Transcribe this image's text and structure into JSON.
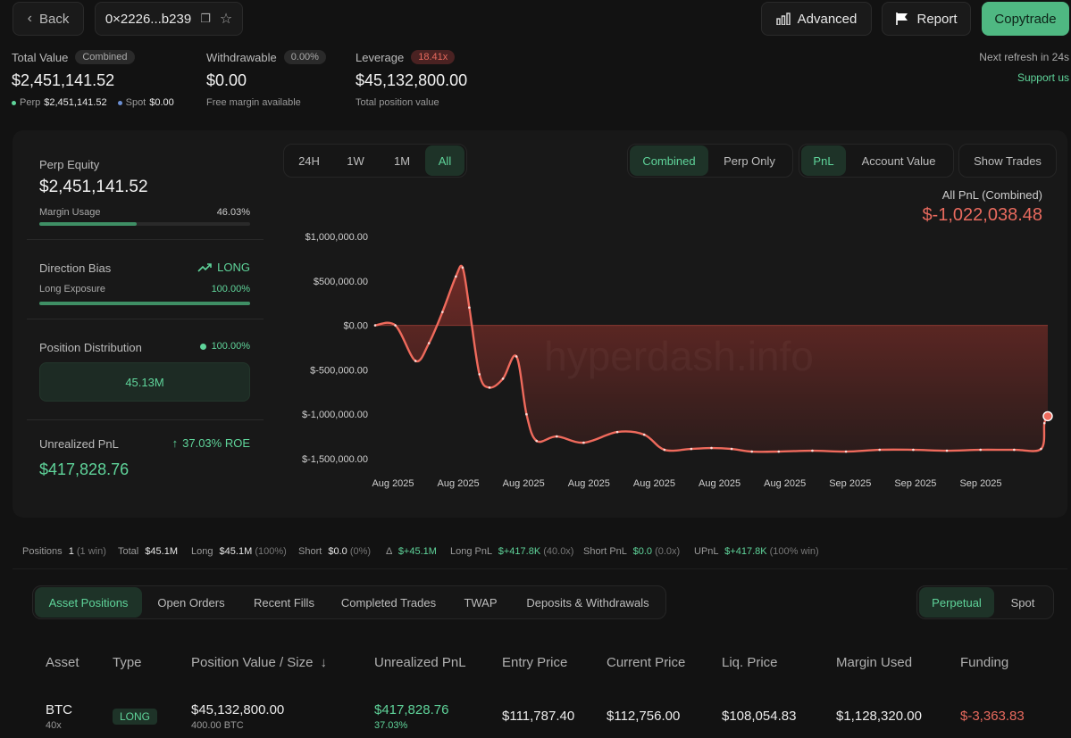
{
  "header": {
    "back_label": "Back",
    "address": "0×2226...b239",
    "advanced_label": "Advanced",
    "report_label": "Report",
    "copytrade_label": "Copytrade"
  },
  "summary": {
    "total_value_label": "Total Value",
    "combined_badge": "Combined",
    "total_value": "$2,451,141.52",
    "perp_label": "Perp",
    "perp_value": "$2,451,141.52",
    "spot_label": "Spot",
    "spot_value": "$0.00",
    "withdrawable_label": "Withdrawable",
    "withdrawable_pct": "0.00%",
    "withdrawable_value": "$0.00",
    "withdrawable_sub": "Free margin available",
    "leverage_label": "Leverage",
    "leverage_badge": "18.41x",
    "leverage_value": "$45,132,800.00",
    "leverage_sub": "Total position value",
    "refresh_text": "Next refresh in 24s",
    "support_text": "Support us"
  },
  "left_panel": {
    "perp_equity_label": "Perp Equity",
    "perp_equity_value": "$2,451,141.52",
    "margin_usage_label": "Margin Usage",
    "margin_usage_value": "46.03%",
    "margin_usage_fraction": 0.4603,
    "direction_bias_label": "Direction Bias",
    "direction_bias_value": "LONG",
    "long_exposure_label": "Long Exposure",
    "long_exposure_value": "100.00%",
    "long_exposure_fraction": 1.0,
    "position_dist_label": "Position Distribution",
    "position_dist_value": "100.00%",
    "position_dist_box": "45.13M",
    "unrealized_label": "Unrealized PnL",
    "unrealized_roe": "37.03% ROE",
    "unrealized_value": "$417,828.76"
  },
  "chart_controls": {
    "ranges": [
      "24H",
      "1W",
      "1M",
      "All"
    ],
    "active_range": "All",
    "modes": [
      "Combined",
      "Perp Only"
    ],
    "active_mode": "Combined",
    "metrics": [
      "PnL",
      "Account Value"
    ],
    "active_metric": "PnL",
    "show_trades_label": "Show Trades",
    "pnl_title": "All PnL (Combined)",
    "pnl_value": "$-1,022,038.48",
    "watermark": "hyperdash.info"
  },
  "chart_data": {
    "type": "area",
    "title": "All PnL (Combined)",
    "y_ticks": [
      "$1,000,000.00",
      "$500,000.00",
      "$0.00",
      "$-500,000.00",
      "$-1,000,000.00",
      "$-1,500,000.00"
    ],
    "y_tick_values": [
      1000000,
      500000,
      0,
      -500000,
      -1000000,
      -1500000
    ],
    "ylim": [
      -1500000,
      1000000
    ],
    "x_ticks": [
      "Aug 2025",
      "Aug 2025",
      "Aug 2025",
      "Aug 2025",
      "Aug 2025",
      "Aug 2025",
      "Aug 2025",
      "Sep 2025",
      "Sep 2025",
      "Sep 2025"
    ],
    "x": [
      0,
      0.03,
      0.06,
      0.08,
      0.1,
      0.12,
      0.13,
      0.14,
      0.155,
      0.17,
      0.19,
      0.21,
      0.225,
      0.24,
      0.27,
      0.31,
      0.36,
      0.4,
      0.43,
      0.47,
      0.5,
      0.53,
      0.56,
      0.6,
      0.65,
      0.7,
      0.75,
      0.8,
      0.85,
      0.9,
      0.95,
      0.99,
      0.995,
      1.0
    ],
    "values": [
      0,
      0,
      -400000,
      -200000,
      150000,
      550000,
      650000,
      200000,
      -550000,
      -700000,
      -600000,
      -350000,
      -1000000,
      -1300000,
      -1250000,
      -1320000,
      -1200000,
      -1230000,
      -1400000,
      -1390000,
      -1380000,
      -1390000,
      -1420000,
      -1420000,
      -1410000,
      -1420000,
      -1400000,
      -1400000,
      -1410000,
      -1400000,
      -1400000,
      -1390000,
      -1100000,
      -1022038
    ]
  },
  "stats_bar": {
    "positions_label": "Positions",
    "positions_value": "1",
    "positions_sub": "(1 win)",
    "total_label": "Total",
    "total_value": "$45.1M",
    "long_label": "Long",
    "long_value": "$45.1M",
    "long_sub": "(100%)",
    "short_label": "Short",
    "short_value": "$0.0",
    "short_sub": "(0%)",
    "delta_label": "Δ",
    "delta_value": "$+45.1M",
    "longpnl_label": "Long PnL",
    "longpnl_value": "$+417.8K",
    "longpnl_sub": "(40.0x)",
    "shortpnl_label": "Short PnL",
    "shortpnl_value": "$0.0",
    "shortpnl_sub": "(0.0x)",
    "upnl_label": "UPnL",
    "upnl_value": "$+417.8K",
    "upnl_sub": "(100% win)"
  },
  "tabs": {
    "items": [
      "Asset Positions",
      "Open Orders",
      "Recent Fills",
      "Completed Trades",
      "TWAP",
      "Deposits & Withdrawals"
    ],
    "active": "Asset Positions",
    "market_items": [
      "Perpetual",
      "Spot"
    ],
    "market_active": "Perpetual"
  },
  "table": {
    "headers": [
      "Asset",
      "Type",
      "Position Value / Size",
      "Unrealized PnL",
      "Entry Price",
      "Current Price",
      "Liq. Price",
      "Margin Used",
      "Funding"
    ],
    "sort_arrow": "↓",
    "rows": [
      {
        "asset": "BTC",
        "leverage": "40x",
        "type": "LONG",
        "position_value": "$45,132,800.00",
        "size": "400.00 BTC",
        "upnl": "$417,828.76",
        "upnl_pct": "37.03%",
        "entry": "$111,787.40",
        "current": "$112,756.00",
        "liq": "$108,054.83",
        "margin": "$1,128,320.00",
        "funding": "$-3,363.83"
      }
    ]
  },
  "colors": {
    "green": "#5fd49a",
    "red": "#e86a5e",
    "accent_bg": "#1e3328",
    "copytrade_bg": "#4fb882"
  }
}
